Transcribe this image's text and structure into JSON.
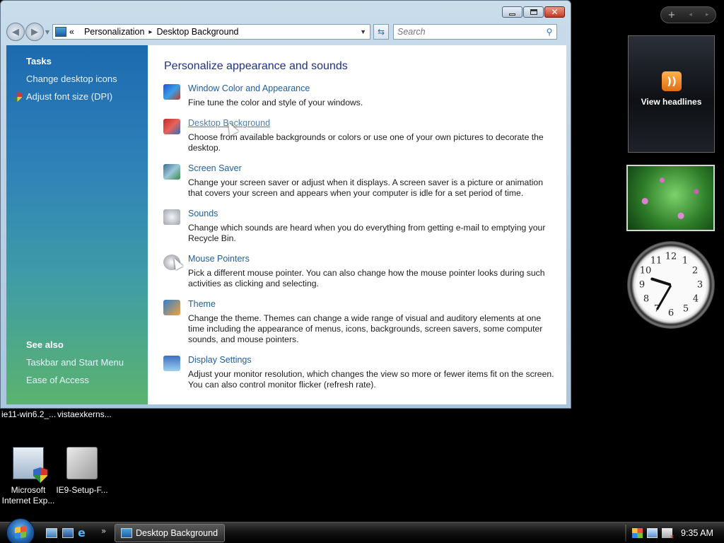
{
  "window": {
    "title": "Desktop Background",
    "caption": {
      "minimize": "minimize",
      "maximize": "maximize",
      "close": "✕"
    }
  },
  "address": {
    "chevrons": "«",
    "crumbs": [
      "Personalization",
      "Desktop Background"
    ],
    "separator": "▸",
    "search_placeholder": "Search"
  },
  "left_pane": {
    "tasks_heading": "Tasks",
    "tasks": [
      "Change desktop icons",
      "Adjust font size (DPI)"
    ],
    "see_also_heading": "See also",
    "see_also": [
      "Taskbar and Start Menu",
      "Ease of Access"
    ]
  },
  "main": {
    "title": "Personalize appearance and sounds",
    "items": [
      {
        "icon": "window-color-icon",
        "title": "Window Color and Appearance",
        "desc": "Fine tune the color and style of your windows."
      },
      {
        "icon": "desktop-background-icon",
        "title": "Desktop Background",
        "desc": "Choose from available backgrounds or colors or use one of your own pictures to decorate the desktop."
      },
      {
        "icon": "screen-saver-icon",
        "title": "Screen Saver",
        "desc": "Change your screen saver or adjust when it displays. A screen saver is a picture or animation that covers your screen and appears when your computer is idle for a set period of time."
      },
      {
        "icon": "sounds-icon",
        "title": "Sounds",
        "desc": "Change which sounds are heard when you do everything from getting e-mail to emptying your Recycle Bin."
      },
      {
        "icon": "mouse-pointers-icon",
        "title": "Mouse Pointers",
        "desc": "Pick a different mouse pointer. You can also change how the mouse pointer looks during such activities as clicking and selecting."
      },
      {
        "icon": "theme-icon",
        "title": "Theme",
        "desc": "Change the theme. Themes can change a wide range of visual and auditory elements at one time including the appearance of menus, icons, backgrounds, screen savers, some computer sounds, and mouse pointers."
      },
      {
        "icon": "display-settings-icon",
        "title": "Display Settings",
        "desc": "Adjust your monitor resolution, which changes the view so more or fewer items fit on the screen. You can also control monitor flicker (refresh rate)."
      }
    ]
  },
  "sidebar": {
    "pill": {
      "add": "+",
      "prev": "◂",
      "next": "▸"
    },
    "feed_label": "View headlines",
    "clock": {
      "numbers": [
        "12",
        "1",
        "2",
        "3",
        "4",
        "5",
        "6",
        "7",
        "8",
        "9",
        "10",
        "11"
      ],
      "time": "9:35"
    }
  },
  "desktop": {
    "truncated_labels": [
      "ie11-win6.2_...",
      "vistaexkerns..."
    ],
    "icons": [
      {
        "label_line1": "Microsoft",
        "label_line2": "Internet Exp..."
      },
      {
        "label_line1": "IE9-Setup-F...",
        "label_line2": ""
      }
    ]
  },
  "taskbar": {
    "task_button": "Desktop Background",
    "more": "»",
    "clock": "9:35 AM"
  },
  "colors": {
    "accent_link": "#1f5e9c",
    "title_blue": "#1e3287"
  }
}
